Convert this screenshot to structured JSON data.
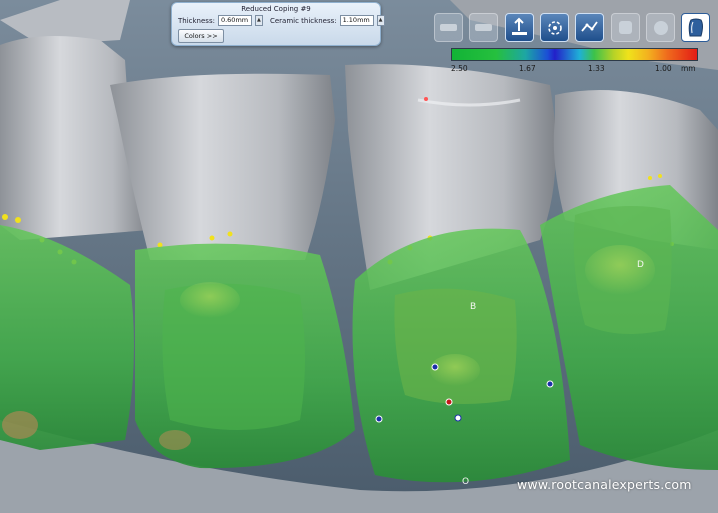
{
  "panel": {
    "title": "Reduced Coping #9",
    "thickness_label": "Thickness:",
    "thickness_value": "0.60mm",
    "ceramic_label": "Ceramic thickness:",
    "ceramic_value": "1.10mm",
    "colors_button": "Colors >>"
  },
  "toolbar": {
    "tools": [
      {
        "name": "tool-1-icon",
        "state": "disabled"
      },
      {
        "name": "tool-2-icon",
        "state": "disabled"
      },
      {
        "name": "insertion-direction-icon",
        "state": "active"
      },
      {
        "name": "rotate-view-icon",
        "state": "active"
      },
      {
        "name": "thickness-map-icon",
        "state": "active"
      },
      {
        "name": "tool-6-icon",
        "state": "disabled"
      },
      {
        "name": "tool-7-icon",
        "state": "disabled"
      },
      {
        "name": "tooth-outline-icon",
        "state": "selected"
      }
    ]
  },
  "scale": {
    "labels": [
      "2.50",
      "1.67",
      "1.33",
      "1.00"
    ],
    "unit": "mm"
  },
  "scene_labels": {
    "b": "B",
    "d": "D",
    "o": "O"
  },
  "watermark": "www.rootcanalexperts.com"
}
